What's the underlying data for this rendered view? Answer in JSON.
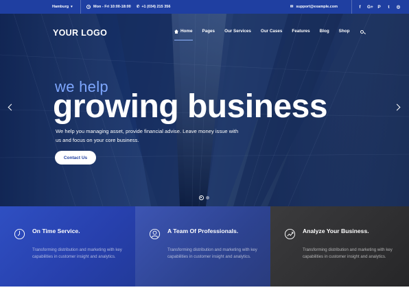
{
  "topbar": {
    "location": "Hamburg",
    "hours": "Mon - Fri 10:00-18:00",
    "phone": "+1 (034) 215 356",
    "email": "support@example.com",
    "social": [
      "f",
      "G+",
      "P",
      "t",
      "ig"
    ]
  },
  "header": {
    "logo": "YOUR LOGO",
    "nav": [
      "Home",
      "Pages",
      "Our Services",
      "Our Cases",
      "Features",
      "Blog",
      "Shop"
    ]
  },
  "hero": {
    "kicker": "we help",
    "headline": "growing business",
    "lead": "We help you managing asset, provide financial advise. Leave money issue with us and focus on your core business.",
    "cta": "Contact Us",
    "slides_total": 2,
    "slide_active": 1
  },
  "features": [
    {
      "title": "On Time Service.",
      "text": "Transforming distribution and marketing with key capabilities in customer insight and analytics.",
      "icon": "clock-icon"
    },
    {
      "title": "A Team Of Professionals.",
      "text": "Transforming distribution and marketing with key capabilities in customer insight and analytics.",
      "icon": "user-icon"
    },
    {
      "title": "Analyze Your Business.",
      "text": "Transforming distribution and marketing with key capabilities in customer insight and analytics.",
      "icon": "chart-icon"
    }
  ],
  "colors": {
    "primary": "#1f3fa1",
    "accent": "#7ea7ff",
    "dark": "#2f2f31"
  }
}
